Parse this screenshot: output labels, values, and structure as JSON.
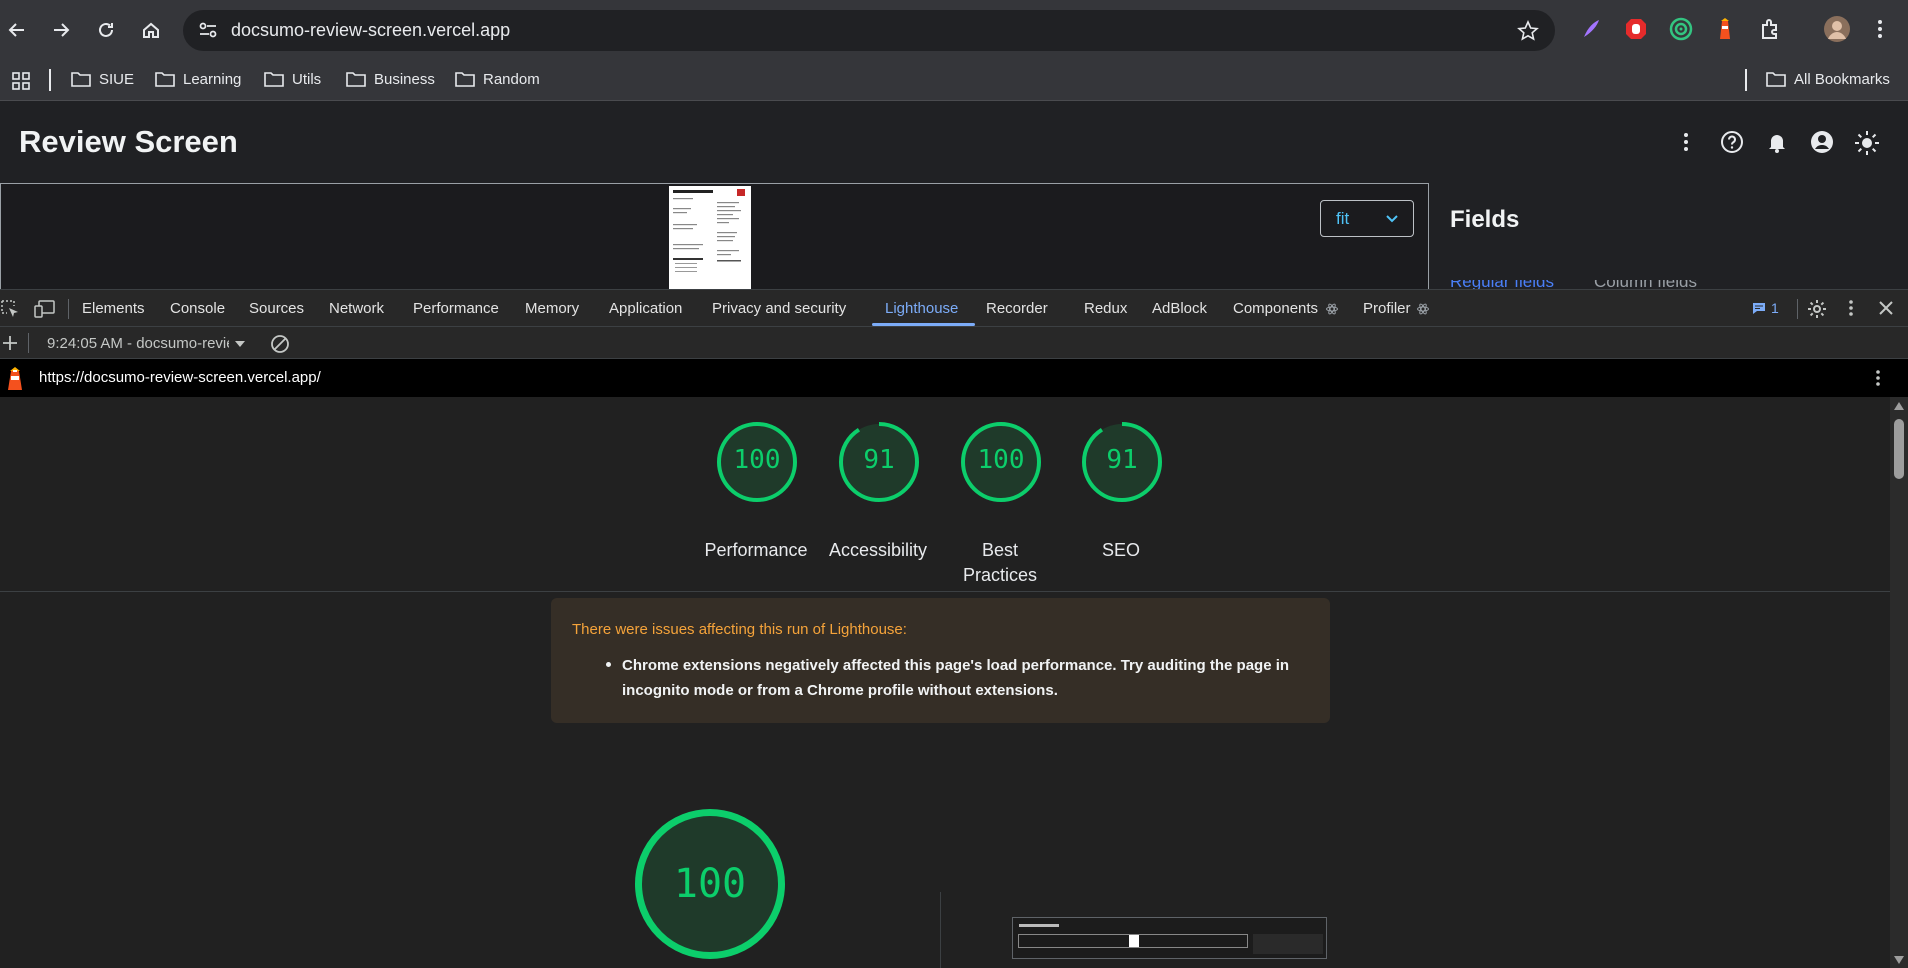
{
  "browser": {
    "url": "docsumo-review-screen.vercel.app",
    "bookmarks": [
      "SIUE",
      "Learning",
      "Utils",
      "Business",
      "Random"
    ],
    "all_bookmarks": "All Bookmarks"
  },
  "app": {
    "title": "Review Screen",
    "zoom_select": "fit",
    "fields_title": "Fields",
    "field_tabs": [
      "Regular fields",
      "Column fields"
    ]
  },
  "devtools": {
    "tabs": [
      "Elements",
      "Console",
      "Sources",
      "Network",
      "Performance",
      "Memory",
      "Application",
      "Privacy and security",
      "Lighthouse",
      "Recorder",
      "Redux",
      "AdBlock",
      "Components",
      "Profiler"
    ],
    "active_tab": "Lighthouse",
    "issues_count": "1",
    "report_selector": "9:24:05 AM - docsumo-revie",
    "report_url": "https://docsumo-review-screen.vercel.app/"
  },
  "lighthouse": {
    "scores": [
      {
        "label": "Performance",
        "value": "100",
        "fraction": 1.0
      },
      {
        "label": "Accessibility",
        "value": "91",
        "fraction": 0.91
      },
      {
        "label": "Best Practices",
        "value": "100",
        "fraction": 1.0
      },
      {
        "label": "SEO",
        "value": "91",
        "fraction": 0.91
      }
    ],
    "warning_heading": "There were issues affecting this run of Lighthouse:",
    "warning_item": "Chrome extensions negatively affected this page's load performance. Try auditing the page in incognito mode or from a Chrome profile without extensions.",
    "big_score": {
      "value": "100",
      "fraction": 1.0
    },
    "colors": {
      "pass": "#0cce6b",
      "warn_bg": "#352e26",
      "warn_text": "#f5a33a"
    }
  }
}
